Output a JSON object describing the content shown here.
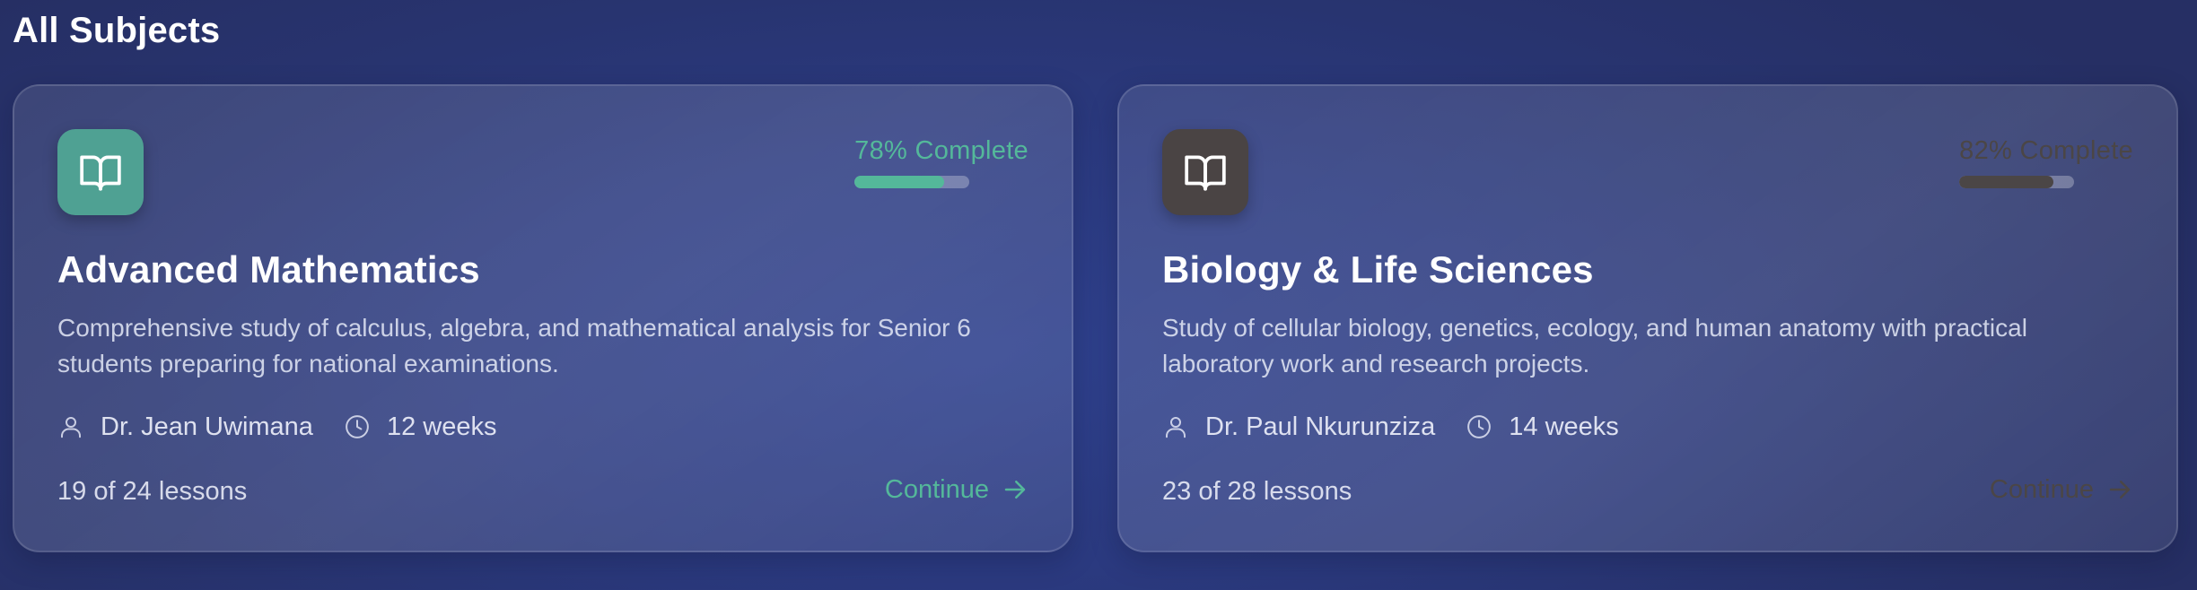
{
  "section": {
    "title": "All Subjects"
  },
  "subjects": [
    {
      "icon": "book-open-icon",
      "icon_bg": "#4fa193",
      "accent": "#54b89a",
      "progress_text": "78% Complete",
      "progress": 0.78,
      "title": "Advanced Mathematics",
      "description": "Comprehensive study of calculus, algebra, and mathematical analysis for Senior 6 students preparing for national examinations.",
      "instructor": "Dr. Jean Uwimana",
      "duration": "12 weeks",
      "lessons": "19 of 24 lessons",
      "continue_label": "Continue"
    },
    {
      "icon": "book-open-icon",
      "icon_bg": "#4a4444",
      "accent": "#4b4646",
      "progress_text": "82% Complete",
      "progress": 0.82,
      "title": "Biology & Life Sciences",
      "description": "Study of cellular biology, genetics, ecology, and human anatomy with practical laboratory work and research projects.",
      "instructor": "Dr. Paul Nkurunziza",
      "duration": "14 weeks",
      "lessons": "23 of 28 lessons",
      "continue_label": "Continue"
    }
  ]
}
